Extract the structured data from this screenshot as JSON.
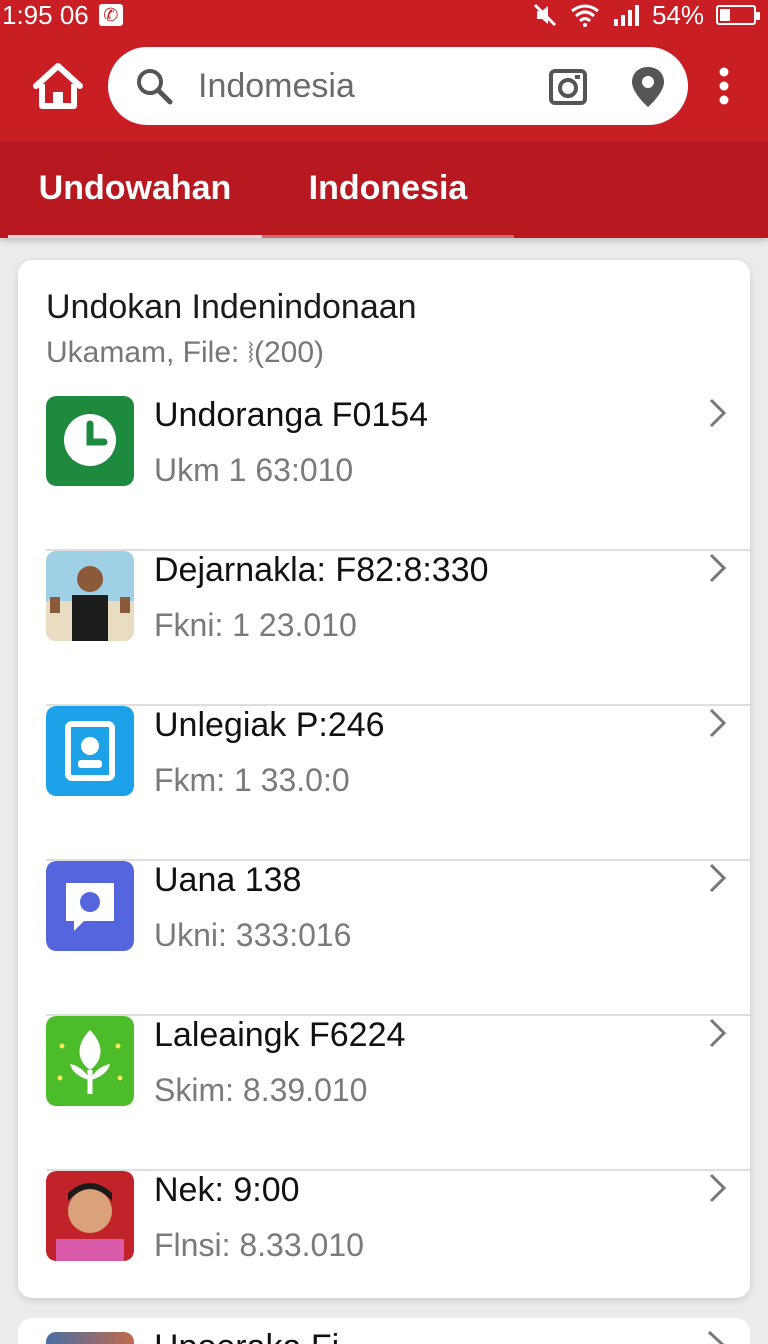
{
  "status_bar": {
    "time": "1:95 06",
    "notification_icon": "app-notification-icon",
    "battery_text": "54%",
    "icons": [
      "mute-icon",
      "wifi-icon",
      "signal-icon",
      "battery-icon"
    ]
  },
  "toolbar": {
    "home_icon": "home-icon",
    "search_placeholder": "Indomesia",
    "camera_icon": "camera-icon",
    "location_icon": "location-pin-icon",
    "more_icon": "more-vert-icon"
  },
  "tabs": [
    {
      "label": "Undowahan"
    },
    {
      "label": "Indonesia"
    }
  ],
  "card": {
    "title": "Undokan Indenindonaan",
    "subtitle": "Ukamam, File: ⧘(200)",
    "items": [
      {
        "title": "Undoranga F0154",
        "subtitle": "Ukm 1 63:010",
        "icon": "green-chat-app-icon",
        "icon_color": "#1e8a3e"
      },
      {
        "title": "Dejarnakla: F82:8:330",
        "subtitle": "Fkni: 1 23.010",
        "icon": "person-photo-thumbnail",
        "icon_color": "#7fb6d0"
      },
      {
        "title": "Unlegiak P:246",
        "subtitle": "Fkm: 1 33.0:0",
        "icon": "contact-card-app-icon",
        "icon_color": "#1da1e8"
      },
      {
        "title": "Uana 138",
        "subtitle": "Ukni: 333:016",
        "icon": "message-bubble-app-icon",
        "icon_color": "#5565dd"
      },
      {
        "title": "Laleaingk F6224",
        "subtitle": "Skim: 8.39.010",
        "icon": "leaf-app-icon",
        "icon_color": "#4cbc2a"
      },
      {
        "title": "Nek: 9:00",
        "subtitle": "Flnsi: 8.33.010",
        "icon": "person-portrait-thumbnail",
        "icon_color": "#c0242a"
      }
    ]
  },
  "peek_item": {
    "title": "Hpoeraka Fi..."
  },
  "colors": {
    "brand_red": "#c81e24",
    "tab_red": "#b8181f",
    "background": "#ececec"
  }
}
